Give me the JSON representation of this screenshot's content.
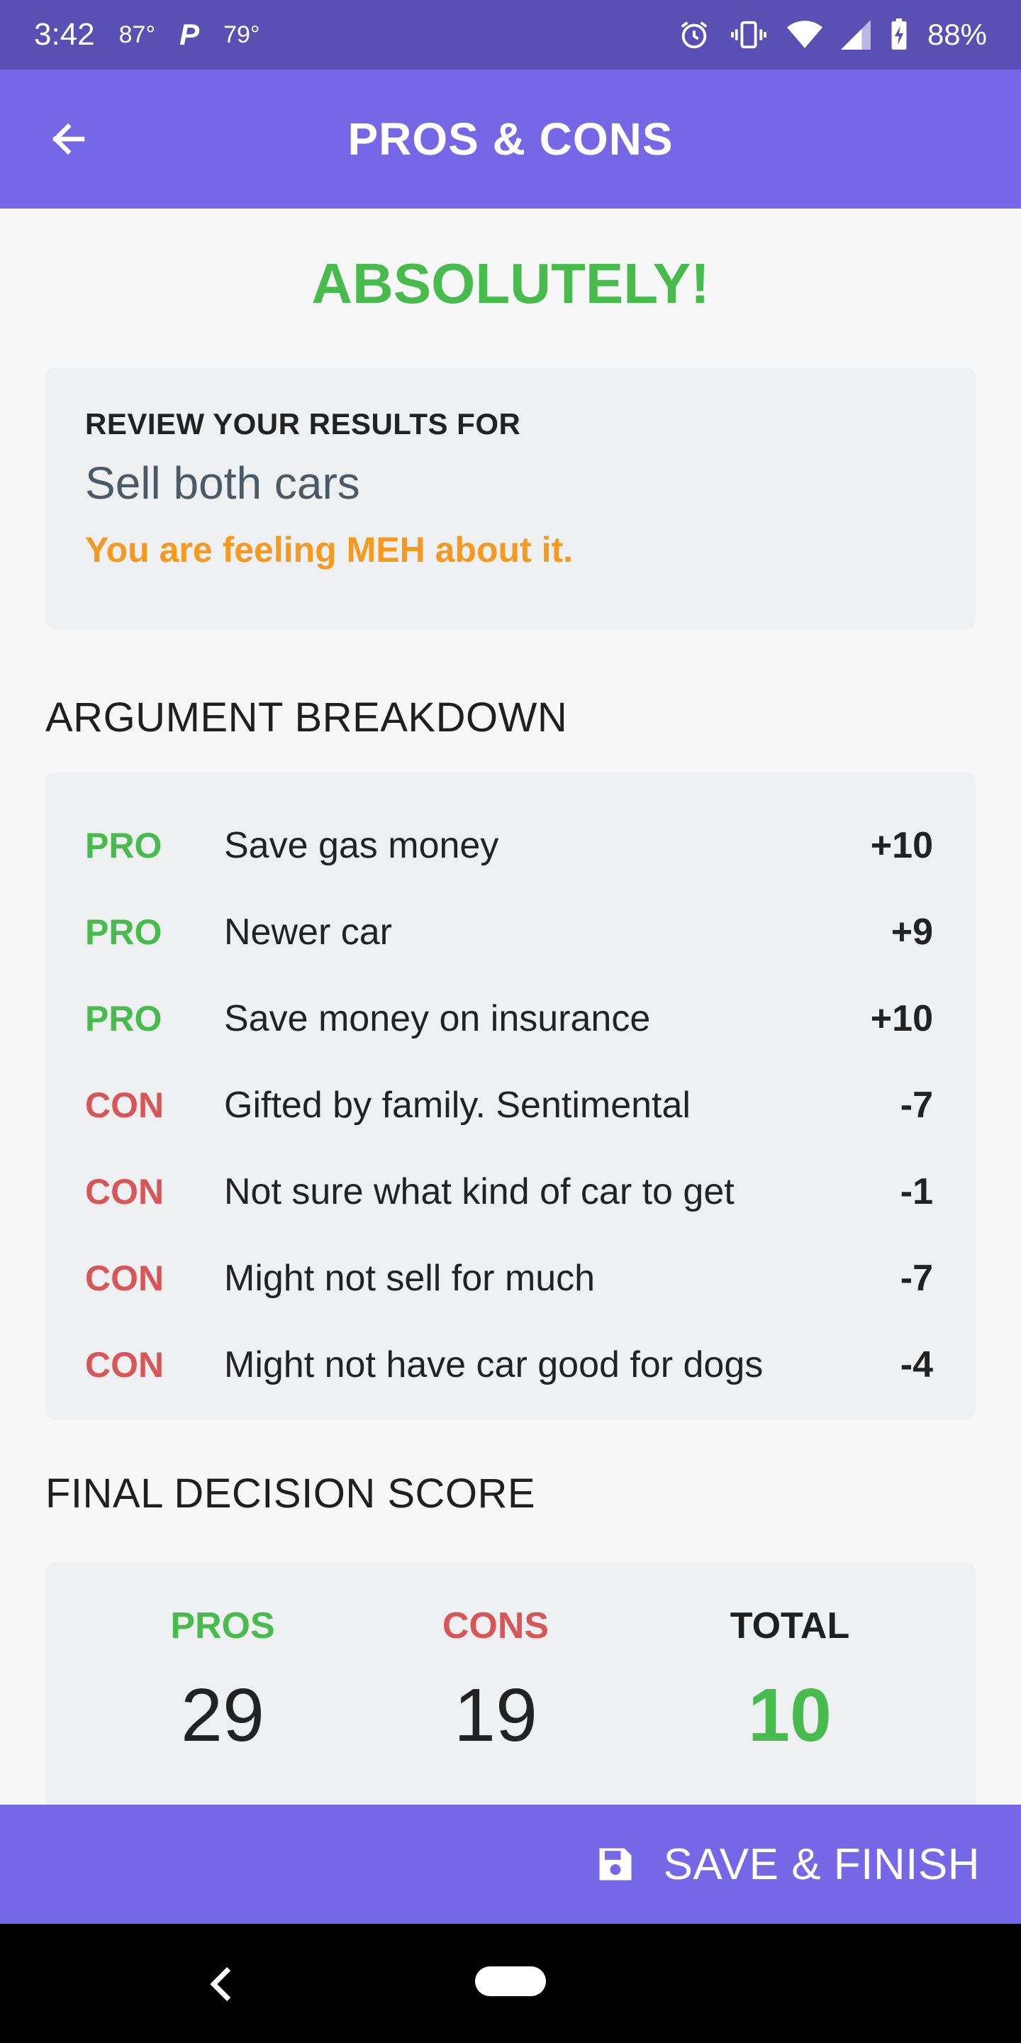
{
  "status_bar": {
    "time": "3:42",
    "temp_1": "87°",
    "app_icon": "P",
    "temp_2": "79°",
    "battery": "88%",
    "icons": [
      "alarm-icon",
      "vibrate-icon",
      "wifi-icon",
      "signal-icon",
      "battery-charging-icon"
    ]
  },
  "app_bar": {
    "title": "PROS & CONS",
    "back_icon": "arrow-left-icon"
  },
  "verdict": "ABSOLUTELY!",
  "review": {
    "heading": "REVIEW YOUR RESULTS FOR",
    "subject": "Sell both cars",
    "feeling": "You are feeling MEH about it."
  },
  "breakdown": {
    "title": "ARGUMENT BREAKDOWN",
    "arguments": [
      {
        "type": "PRO",
        "text": "Save gas money",
        "score": "+10"
      },
      {
        "type": "PRO",
        "text": "Newer car",
        "score": "+9"
      },
      {
        "type": "PRO",
        "text": "Save money on insurance",
        "score": "+10"
      },
      {
        "type": "CON",
        "text": "Gifted by family. Sentimental",
        "score": "-7"
      },
      {
        "type": "CON",
        "text": "Not sure what kind of car to get",
        "score": "-1"
      },
      {
        "type": "CON",
        "text": "Might not sell for much",
        "score": "-7"
      },
      {
        "type": "CON",
        "text": "Might not have car good for dogs",
        "score": "-4"
      }
    ]
  },
  "final_score": {
    "title": "FINAL DECISION SCORE",
    "pros_label": "PROS",
    "pros_value": "29",
    "cons_label": "CONS",
    "cons_value": "19",
    "total_label": "TOTAL",
    "total_value": "10"
  },
  "save_bar": {
    "label": "SAVE & FINISH",
    "icon": "floppy-disk-icon"
  },
  "colors": {
    "status_bar": "#5a4fb3",
    "primary": "#7567e6",
    "pro": "#48bb4d",
    "con": "#d85558",
    "feeling": "#f5991f",
    "card": "#eef0f2"
  }
}
